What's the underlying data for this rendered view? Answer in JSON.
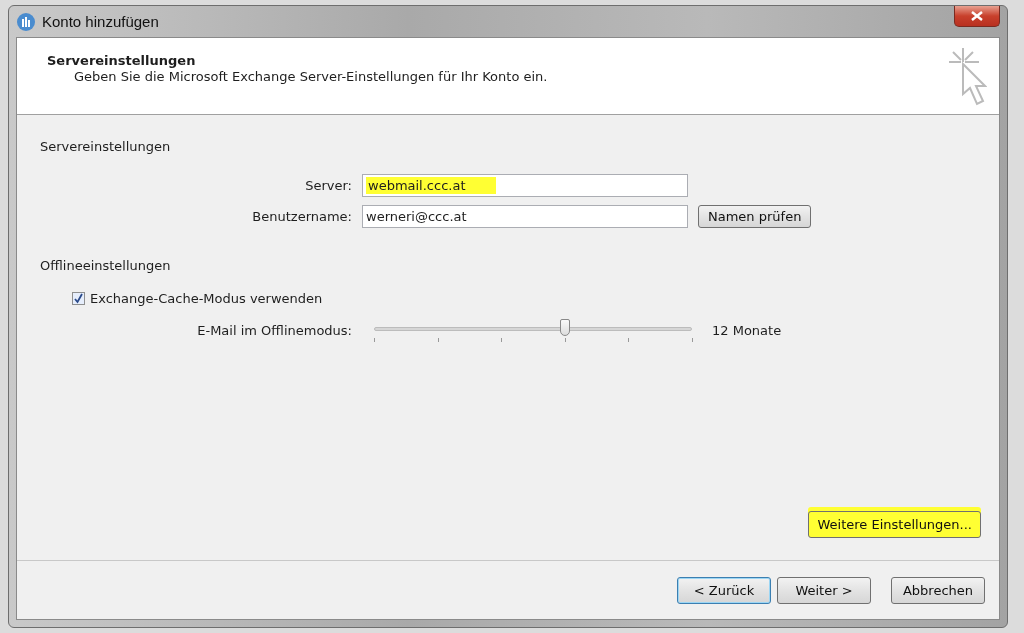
{
  "window": {
    "title": "Konto hinzufügen"
  },
  "header": {
    "title": "Servereinstellungen",
    "subtitle": "Geben Sie die Microsoft Exchange Server-Einstellungen für Ihr Konto ein."
  },
  "server_section": {
    "heading": "Servereinstellungen",
    "fields": [
      {
        "label": "Server:",
        "value": "webmail.ccc.at",
        "highlighted": true
      },
      {
        "label": "Benutzername:",
        "value": "werneri@ccc.at",
        "highlighted": false
      }
    ],
    "check_button": {
      "label": "Namen prüfen"
    }
  },
  "offline_section": {
    "heading": "Offlineeinstellungen",
    "cache_mode": {
      "label": "Exchange-Cache-Modus verwenden",
      "checked": true
    },
    "slider": {
      "label": "E-Mail im Offlinemodus:",
      "level": 0.6,
      "reading": "12 Monate"
    }
  },
  "more_button": {
    "label": "Weitere Einstellungen...",
    "highlighted": true
  },
  "footer_buttons": [
    {
      "label": "< Zurück",
      "selected": true
    },
    {
      "label": "Weiter >",
      "selected": false
    },
    {
      "label": "Abbrechen",
      "selected": false
    }
  ]
}
